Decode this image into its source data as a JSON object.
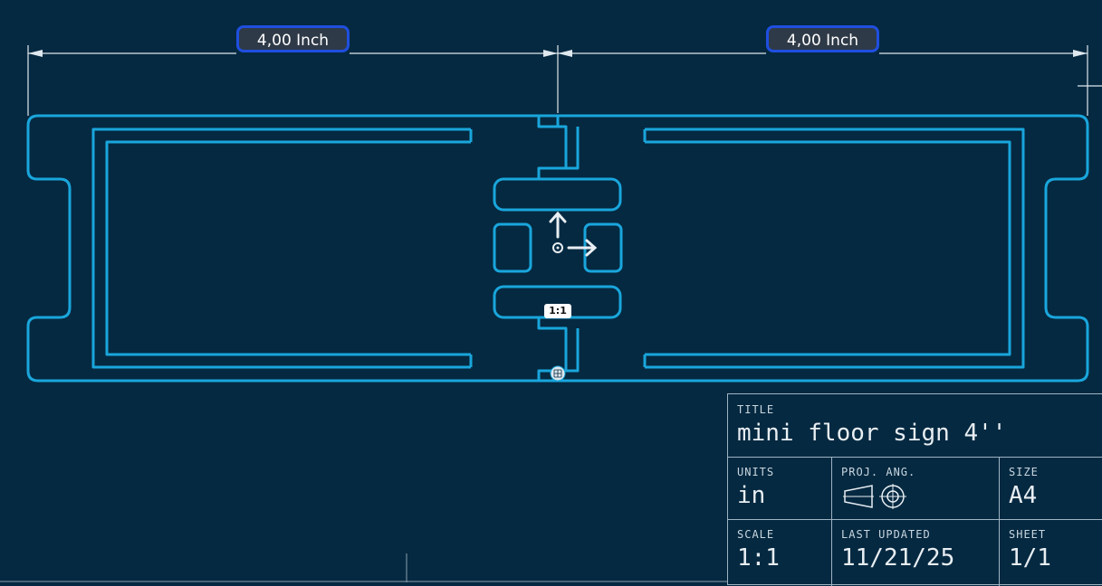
{
  "dimensions": {
    "left_label": "4,00 Inch",
    "right_label": "4,00 Inch"
  },
  "scale_badge": "1:1",
  "colors": {
    "background": "#052941",
    "part_outline": "#19a6dc",
    "dimension_lines": "#dfe8ee",
    "dimension_label_border": "#1f4fe0"
  },
  "icons": {
    "origin": "origin-axes-icon",
    "mate_connector": "mate-connector-icon",
    "projection": "third-angle-projection-icon"
  },
  "title_block": {
    "title_label": "TITLE",
    "title_value": "mini floor sign 4''",
    "units_label": "UNITS",
    "units_value": "in",
    "proj_label": "PROJ. ANG.",
    "size_label": "SIZE",
    "size_value": "A4",
    "scale_label": "SCALE",
    "scale_value": "1:1",
    "updated_label": "LAST UPDATED",
    "updated_value": "11/21/25",
    "sheet_label": "SHEET",
    "sheet_value": "1/1"
  }
}
